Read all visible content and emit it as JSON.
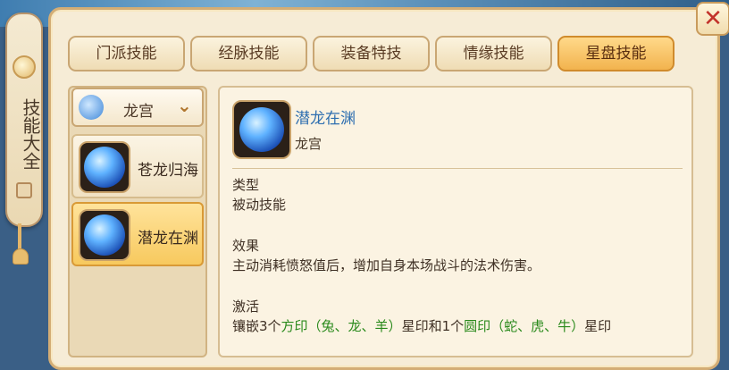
{
  "sidebar_tab": {
    "title": "技能大全"
  },
  "close_label": "✕",
  "tabs": [
    {
      "label": "门派技能",
      "active": false
    },
    {
      "label": "经脉技能",
      "active": false
    },
    {
      "label": "装备特技",
      "active": false
    },
    {
      "label": "情缘技能",
      "active": false
    },
    {
      "label": "星盘技能",
      "active": true
    }
  ],
  "school_select": {
    "value": "龙宫",
    "chevron": "⌄"
  },
  "skills": [
    {
      "name": "苍龙归海",
      "selected": false
    },
    {
      "name": "潜龙在渊",
      "selected": true
    }
  ],
  "detail": {
    "name": "潜龙在渊",
    "school": "龙宫",
    "type_title": "类型",
    "type_value": "被动技能",
    "effect_title": "效果",
    "effect_value": "主动消耗愤怒值后，增加自身本场战斗的法术伤害。",
    "activation_title": "激活",
    "activation_parts": {
      "p1": "镶嵌3个",
      "p2": "方印（兔、龙、羊）",
      "p3": "星印和1个",
      "p4": "圆印（蛇、虎、牛）",
      "p5": "星印"
    }
  },
  "colors": {
    "accent": "#f2b34e",
    "skill_name": "#2f6fb0",
    "highlight": "#2a8a1c"
  }
}
